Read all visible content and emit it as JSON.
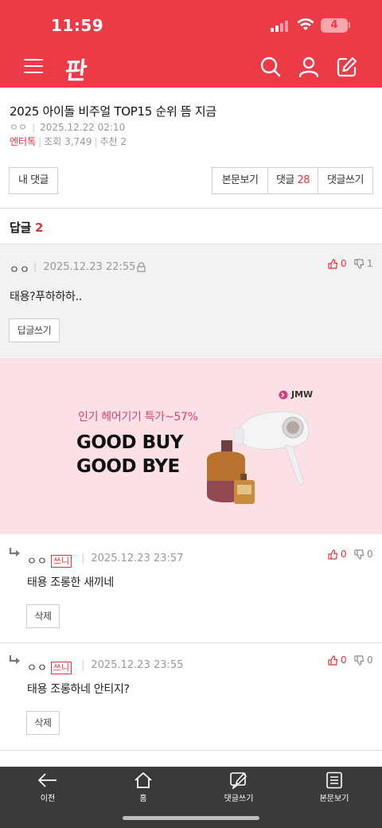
{
  "status_bar": {
    "time": "11:59",
    "battery": "4"
  },
  "header": {
    "logo": "판"
  },
  "post": {
    "title": "2025 아이돌 비주얼 TOP15 순위 뜸 지금",
    "author": "ㅇㅇ",
    "date": "2025.12.22 02:10",
    "category": "엔터톡",
    "views": "조회 3,749",
    "recommends": "추천 2"
  },
  "actions": {
    "my_comments": "내 댓글",
    "view_body": "본문보기",
    "comments_label": "댓글",
    "comments_count": "28",
    "write_comment": "댓글쓰기"
  },
  "replies": {
    "label": "답글",
    "count": "2"
  },
  "main_comment": {
    "author": "ㅇㅇ",
    "date": "2025.12.23 22:55",
    "text": "태용?푸하하하..",
    "up": "0",
    "down": "1",
    "reply_button": "답글쓰기"
  },
  "ad": {
    "brand": "JMW",
    "subtitle": "인기 헤어기기 특가~57%",
    "line1": "GOOD BUY",
    "line2": "GOOD BYE"
  },
  "reply_list": [
    {
      "author": "ㅇㅇ",
      "badge": "쓰니",
      "date": "2025.12.23 23:57",
      "text": "태용 조롱한 새끼네",
      "up": "0",
      "down": "0",
      "delete": "삭제"
    },
    {
      "author": "ㅇㅇ",
      "badge": "쓰니",
      "date": "2025.12.23 23:55",
      "text": "태용 조롱하네 안티지?",
      "up": "0",
      "down": "0",
      "delete": "삭제"
    }
  ],
  "bottom_nav": {
    "prev": "이전",
    "home": "홈",
    "write": "댓글쓰기",
    "body": "본문보기"
  },
  "colors": {
    "brand_red": "#ec3a47",
    "accent_red": "#e3313d",
    "ad_bg": "#fbe1e6",
    "nav_bg": "#3a3a3a"
  }
}
